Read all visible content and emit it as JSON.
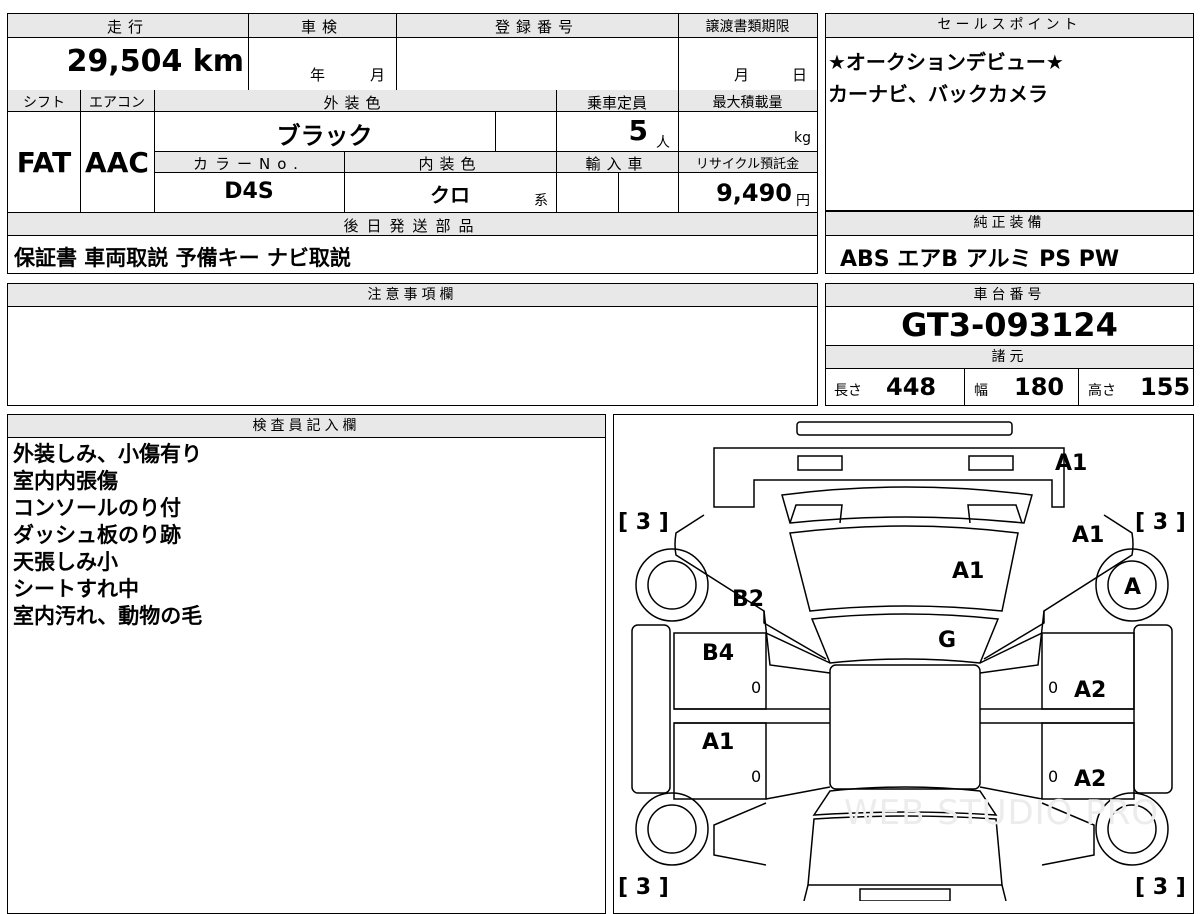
{
  "vehicle": {
    "mileage_label": "走行",
    "mileage": "29,504 km",
    "inspection_label": "車検",
    "inspection_year": "年",
    "inspection_month": "月",
    "registration_label": "登録番号",
    "transfer_label": "譲渡書類期限",
    "transfer_month": "月",
    "transfer_day": "日",
    "shift_label": "シフト",
    "shift": "FAT",
    "ac_label": "エアコン",
    "ac": "AAC",
    "exterior_label": "外装色",
    "exterior": "ブラック",
    "capacity_label": "乗車定員",
    "capacity": "5",
    "capacity_unit": "人",
    "maxload_label": "最大積載量",
    "maxload_unit": "kg",
    "color_no_label": "カラーNo.",
    "color_no": "D4S",
    "interior_label": "内装色",
    "interior": "クロ",
    "interior_suffix": "系",
    "import_label": "輸入車",
    "recycle_label": "リサイクル預託金",
    "recycle": "9,490",
    "recycle_unit": "円",
    "later_label": "後日発送部品",
    "later_items": "保証書 車両取説 予備キー ナビ取説"
  },
  "sales": {
    "label": "セールスポイント",
    "line1": "★オークションデビュー★",
    "line2": "カーナビ、バックカメラ"
  },
  "equipment": {
    "label": "純正装備",
    "items": "ABS エアB アルミ PS PW"
  },
  "caution": {
    "label": "注意事項欄"
  },
  "chassis": {
    "label": "車台番号",
    "number": "GT3-093124"
  },
  "specs": {
    "label": "諸元",
    "length_label": "長さ",
    "length": "448",
    "width_label": "幅",
    "width": "180",
    "height_label": "高さ",
    "height": "155"
  },
  "inspector": {
    "label": "検査員記入欄",
    "notes": [
      "外装しみ、小傷有り",
      "室内内張傷",
      "コンソールのり付",
      "ダッシュ板のり跡",
      "天張しみ小",
      "シートすれ中",
      "室内汚れ、動物の毛"
    ]
  },
  "diagram": {
    "grade_tl": "3",
    "grade_tr": "3",
    "grade_bl": "3",
    "grade_br": "3",
    "a1_front": "A1",
    "a1_fender_r": "A1",
    "a1_hood": "A1",
    "a_wheel_r": "A",
    "b2_fender_l": "B2",
    "g_windshield": "G",
    "b4_door_fl": "B4",
    "a1_door_rl": "A1",
    "a2_door_fr": "A2",
    "a2_door_rr": "A2",
    "zero1": "0",
    "zero2": "0",
    "zero3": "0",
    "zero4": "0",
    "watermark": "WEB STUDIO PRO"
  }
}
